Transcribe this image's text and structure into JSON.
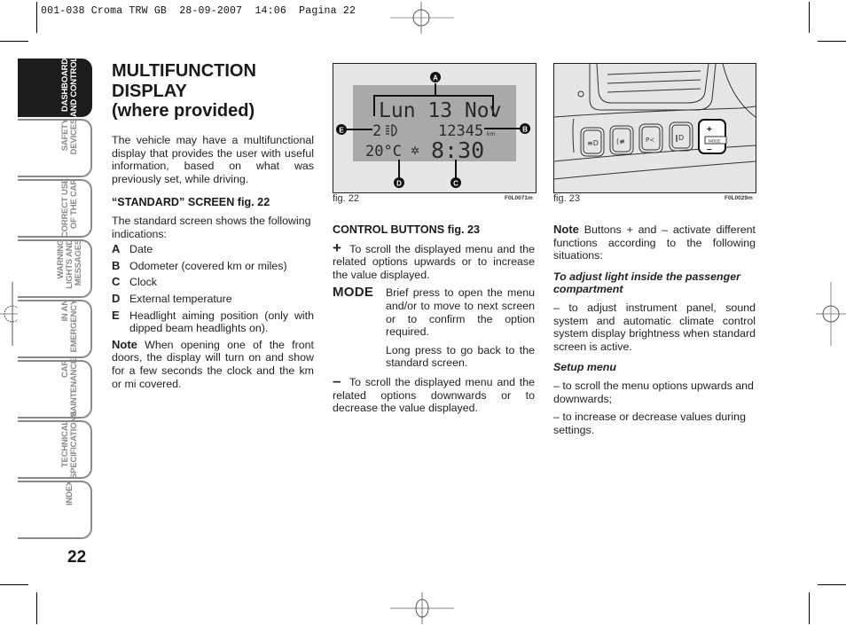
{
  "slug": "001-038 Croma TRW GB  28-09-2007  14:06  Pagina 22",
  "side_tabs": [
    {
      "line1": "DASHBOARD",
      "line2": "AND CONTROLS",
      "active": true
    },
    {
      "line1": "SAFETY",
      "line2": "DEVICES",
      "active": false
    },
    {
      "line1": "CORRECT USE",
      "line2": "OF THE CAR",
      "active": false
    },
    {
      "line1": "WARNING",
      "line2": "LIGHTS AND",
      "line3": "MESSAGES",
      "active": false
    },
    {
      "line1": "IN AN",
      "line2": "EMERGENCY",
      "active": false
    },
    {
      "line1": "CAR",
      "line2": "MAINTENANCE",
      "active": false
    },
    {
      "line1": "TECHNICAL",
      "line2": "SPECIFICATIONS",
      "active": false
    },
    {
      "line1": "INDEX",
      "line2": "",
      "active": false
    }
  ],
  "page_number": "22",
  "section": {
    "title_line1": "MULTIFUNCTION",
    "title_line2": "DISPLAY",
    "title_line3": "(where provided)",
    "intro": "The vehicle may have a multifunctional display that provides the user with useful information, based on what was previously set, while driving.",
    "standard_heading": "“STANDARD” SCREEN fig. 22",
    "standard_text": "The standard screen shows the following indications:",
    "indications": [
      {
        "key": "A",
        "text": "Date"
      },
      {
        "key": "B",
        "text": "Odometer (covered km or miles)"
      },
      {
        "key": "C",
        "text": "Clock"
      },
      {
        "key": "D",
        "text": "External temperature"
      },
      {
        "key": "E",
        "text": "Headlight aiming position (only with dipped beam headlights on)."
      }
    ],
    "note_label": "Note",
    "note_text": "When opening one of the front doors, the display will turn on and show for a few seconds the clock and the km or mi covered."
  },
  "controls": {
    "heading": "CONTROL BUTTONS fig. 23",
    "plus_symbol": "+",
    "plus_text": "To scroll the displayed menu and the related options upwards or to increase the value displayed.",
    "mode_label": "MODE",
    "mode_brief": "Brief press to open the menu and/or to move to next screen or to confirm the option required.",
    "mode_long": "Long press to go back to the standard screen.",
    "minus_symbol": "–",
    "minus_text": "To scroll the displayed menu and the related options downwards or to decrease the value displayed."
  },
  "notes": {
    "note_label": "Note",
    "note_text": "Buttons + and – activate different functions according to the following situations:",
    "light_heading": "To adjust light inside the passenger compartment",
    "light_text": "– to adjust instrument panel, sound system and automatic climate control system display brightness when standard screen is active.",
    "setup_heading": "Setup menu",
    "setup_text1": "– to scroll the menu options upwards and downwards;",
    "setup_text2": "– to increase or decrease values during settings."
  },
  "fig22": {
    "caption": "fig. 22",
    "code": "F0L0071m",
    "display": {
      "date": "Lun 13 Nov",
      "headlight_position": "2",
      "odometer": "12345",
      "odometer_unit": "km",
      "temperature": "20°C",
      "clock": "8:30"
    },
    "callouts": [
      "A",
      "B",
      "C",
      "D",
      "E"
    ]
  },
  "fig23": {
    "caption": "fig. 23",
    "code": "F0L0029m",
    "button_labels": {
      "plus": "+",
      "mode": "MODE",
      "minus": "–"
    }
  }
}
